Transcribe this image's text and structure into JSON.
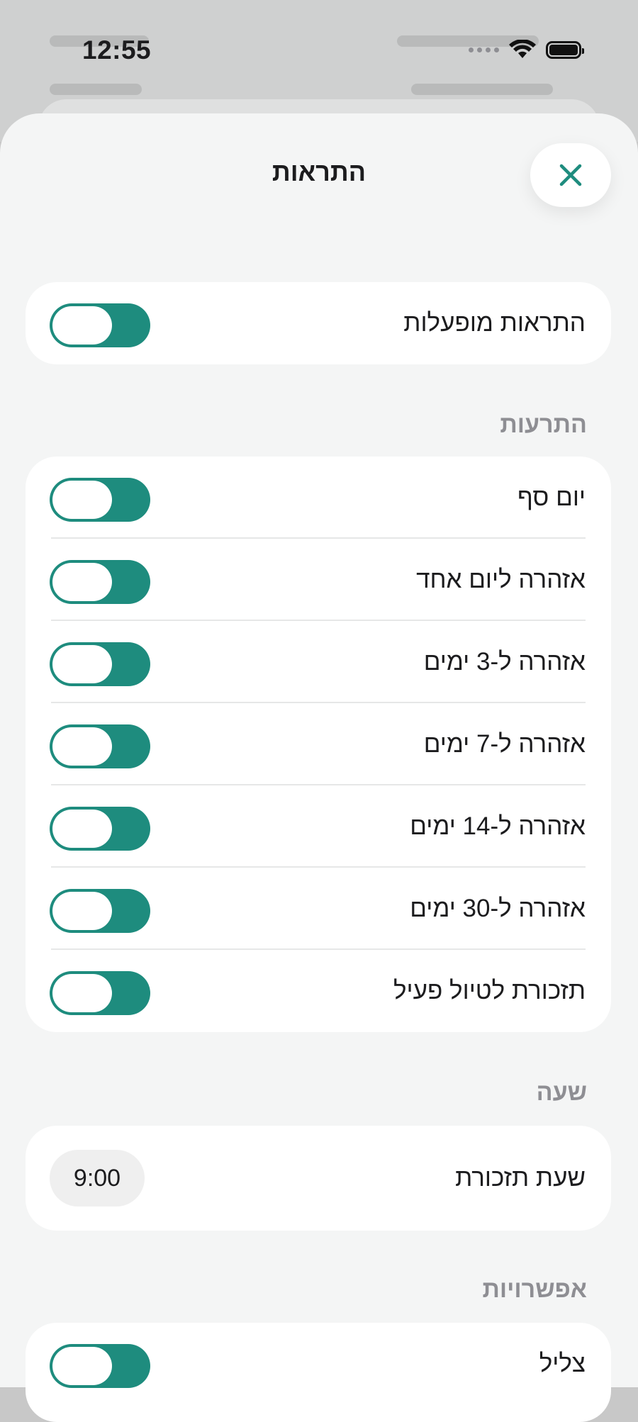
{
  "status_bar": {
    "time": "12:55"
  },
  "sheet": {
    "title": "התראות"
  },
  "master": {
    "label": "התראות מופעלות",
    "enabled": true
  },
  "alerts_section": {
    "header": "התרעות",
    "items": [
      {
        "label": "יום סף",
        "enabled": true
      },
      {
        "label": "אזהרה ליום אחד",
        "enabled": true
      },
      {
        "label": "אזהרה ל-3 ימים",
        "enabled": true
      },
      {
        "label": "אזהרה ל-7 ימים",
        "enabled": true
      },
      {
        "label": "אזהרה ל-14 ימים",
        "enabled": true
      },
      {
        "label": "אזהרה ל-30 ימים",
        "enabled": true
      },
      {
        "label": "תזכורת לטיול פעיל",
        "enabled": true
      }
    ]
  },
  "time_section": {
    "header": "שעה",
    "reminder_label": "שעת תזכורת",
    "reminder_time": "9:00"
  },
  "options_section": {
    "header": "אפשרויות",
    "items": [
      {
        "label": "צליל",
        "enabled": true
      }
    ]
  },
  "colors": {
    "accent": "#1e8c7e",
    "background": "#f4f5f5",
    "card": "#ffffff",
    "section_header": "#8e8e93"
  },
  "icons": {
    "close": "close-icon",
    "wifi": "wifi-icon",
    "battery": "battery-icon",
    "signal": "cellular-signal-icon"
  }
}
